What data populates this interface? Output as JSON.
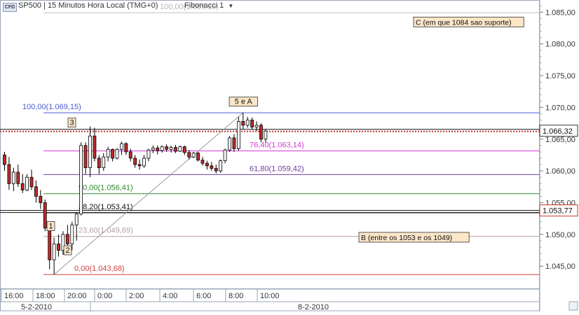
{
  "header": {
    "cfd_badge": "CFD",
    "title": "SP500 | 15 Minutos Hora Local (TMG+0)",
    "fib_selector": "Fibonacci 1",
    "ghost_text": "100,00(1.069,15)"
  },
  "colors": {
    "bull_candle": "#ffffff",
    "bear_candle": "#bf2a2a",
    "fib_100": "#4a5bd6",
    "fib_76": "#d43bd4",
    "fib_61": "#6a3fa0",
    "fib_50": "#2e8b2e",
    "fib_38": "#111111",
    "fib_23": "#b8a0a0",
    "fib_0": "#d04040",
    "price_line": "#c0392b",
    "annotation_bg": "#fbe6c8"
  },
  "chart_data": {
    "type": "candlestick",
    "instrument": "SP500",
    "timeframe": "15 Minutos Hora Local (TMG+0)",
    "y_axis": {
      "side": "right",
      "ticks": [
        "1.045,00",
        "1.050,00",
        "1.055,00",
        "1.060,00",
        "1.065,00",
        "1.070,00",
        "1.075,00",
        "1.080,00",
        "1.085,00"
      ],
      "range": [
        1041.5,
        1086.8
      ]
    },
    "x_axis": {
      "time_ticks": [
        "16:00",
        "18:00",
        "20:00",
        "0:00",
        "2:00",
        "4:00",
        "6:00",
        "8:00",
        "10:00"
      ],
      "date_labels": [
        "5-2-2010",
        "8-2-2010"
      ]
    },
    "current_price": {
      "value": 1066.32,
      "label": "1.066,32"
    },
    "support_line": {
      "value": 1053.77,
      "label": "1.053,77"
    },
    "fibonacci": [
      {
        "key": "fib_100",
        "label": "100,00(1.069,15)",
        "value": 1069.15
      },
      {
        "key": "fib_76",
        "label": "76,40(1.063,14)",
        "value": 1063.14
      },
      {
        "key": "fib_61",
        "label": "61,80(1.059,42)",
        "value": 1059.42
      },
      {
        "key": "fib_50",
        "label": "50,00(1.056,41)",
        "value": 1056.41
      },
      {
        "key": "fib_38",
        "label": "38,20(1.053,41)",
        "value": 1053.41
      },
      {
        "key": "fib_23",
        "label": "23,60(1.049,69)",
        "value": 1049.69
      },
      {
        "key": "fib_0",
        "label": "0,00(1.043,68)",
        "value": 1043.68
      }
    ],
    "wave_labels": [
      {
        "text": "1",
        "value": 1050.7
      },
      {
        "text": "2",
        "value": 1046.9
      },
      {
        "text": "3",
        "value": 1067.0
      },
      {
        "text": "5 e A",
        "value": 1070.3
      }
    ],
    "annotations": [
      {
        "key": "c",
        "text": "C (em que 1084 sao suporte)",
        "value": 1082.9
      },
      {
        "key": "b",
        "text": "B (entre os 1053 e os 1049)",
        "value": 1049.0
      }
    ],
    "candles": [
      [
        1062.5,
        1063.0,
        1060.0,
        1061.0
      ],
      [
        1061.0,
        1062.2,
        1057.0,
        1058.0
      ],
      [
        1058.0,
        1060.5,
        1056.8,
        1059.8
      ],
      [
        1059.8,
        1061.0,
        1057.5,
        1058.0
      ],
      [
        1058.0,
        1059.5,
        1056.5,
        1057.0
      ],
      [
        1057.0,
        1059.5,
        1056.8,
        1059.0
      ],
      [
        1059.0,
        1060.2,
        1057.0,
        1057.5
      ],
      [
        1057.5,
        1058.5,
        1055.0,
        1056.0
      ],
      [
        1056.0,
        1057.0,
        1054.0,
        1055.0
      ],
      [
        1055.0,
        1055.5,
        1050.5,
        1051.0
      ],
      [
        1051.0,
        1051.5,
        1044.5,
        1046.0
      ],
      [
        1046.0,
        1049.5,
        1043.7,
        1048.5
      ],
      [
        1048.5,
        1050.0,
        1046.5,
        1047.5
      ],
      [
        1047.5,
        1050.5,
        1046.8,
        1050.0
      ],
      [
        1050.0,
        1051.5,
        1047.5,
        1048.5
      ],
      [
        1048.5,
        1052.0,
        1047.5,
        1051.5
      ],
      [
        1051.5,
        1053.5,
        1049.0,
        1053.2
      ],
      [
        1053.2,
        1064.5,
        1053.0,
        1064.0
      ],
      [
        1064.0,
        1064.5,
        1059.5,
        1060.5
      ],
      [
        1060.5,
        1067.0,
        1059.0,
        1065.5
      ],
      [
        1065.5,
        1066.8,
        1061.5,
        1062.0
      ],
      [
        1062.0,
        1062.5,
        1059.5,
        1060.5
      ],
      [
        1060.5,
        1062.8,
        1060.0,
        1062.2
      ],
      [
        1062.2,
        1063.8,
        1061.5,
        1063.4
      ],
      [
        1063.4,
        1063.5,
        1061.5,
        1062.0
      ],
      [
        1062.0,
        1063.6,
        1061.8,
        1063.4
      ],
      [
        1063.4,
        1064.6,
        1062.5,
        1064.3
      ],
      [
        1064.3,
        1064.5,
        1062.5,
        1063.0
      ],
      [
        1063.0,
        1063.5,
        1061.5,
        1062.0
      ],
      [
        1062.0,
        1062.5,
        1060.5,
        1061.0
      ],
      [
        1061.0,
        1061.8,
        1060.2,
        1060.8
      ],
      [
        1060.8,
        1062.5,
        1060.5,
        1062.0
      ],
      [
        1062.0,
        1063.5,
        1061.5,
        1063.3
      ],
      [
        1063.3,
        1064.0,
        1062.8,
        1063.6
      ],
      [
        1063.6,
        1064.0,
        1062.6,
        1063.2
      ],
      [
        1063.2,
        1064.0,
        1062.9,
        1063.8
      ],
      [
        1063.8,
        1064.2,
        1063.0,
        1063.4
      ],
      [
        1063.4,
        1064.0,
        1062.9,
        1063.7
      ],
      [
        1063.7,
        1064.1,
        1062.8,
        1063.1
      ],
      [
        1063.1,
        1064.0,
        1063.0,
        1063.8
      ],
      [
        1063.8,
        1064.0,
        1062.5,
        1062.9
      ],
      [
        1062.9,
        1063.3,
        1061.8,
        1062.2
      ],
      [
        1062.2,
        1063.0,
        1062.0,
        1062.8
      ],
      [
        1062.8,
        1063.0,
        1061.5,
        1061.7
      ],
      [
        1061.7,
        1062.2,
        1060.8,
        1061.2
      ],
      [
        1061.2,
        1061.6,
        1060.2,
        1060.8
      ],
      [
        1060.8,
        1061.4,
        1060.0,
        1060.4
      ],
      [
        1060.4,
        1061.0,
        1059.6,
        1060.0
      ],
      [
        1060.0,
        1061.8,
        1059.7,
        1061.6
      ],
      [
        1061.6,
        1063.5,
        1061.2,
        1063.3
      ],
      [
        1063.3,
        1065.5,
        1063.0,
        1065.2
      ],
      [
        1065.2,
        1065.8,
        1063.0,
        1063.5
      ],
      [
        1063.5,
        1068.5,
        1063.2,
        1067.8
      ],
      [
        1067.8,
        1069.2,
        1066.5,
        1067.2
      ],
      [
        1067.2,
        1068.5,
        1066.8,
        1068.0
      ],
      [
        1068.0,
        1068.4,
        1066.5,
        1066.9
      ],
      [
        1066.9,
        1067.8,
        1066.3,
        1067.2
      ],
      [
        1067.2,
        1067.5,
        1064.5,
        1065.0
      ],
      [
        1065.0,
        1066.5,
        1064.5,
        1066.3
      ]
    ]
  }
}
